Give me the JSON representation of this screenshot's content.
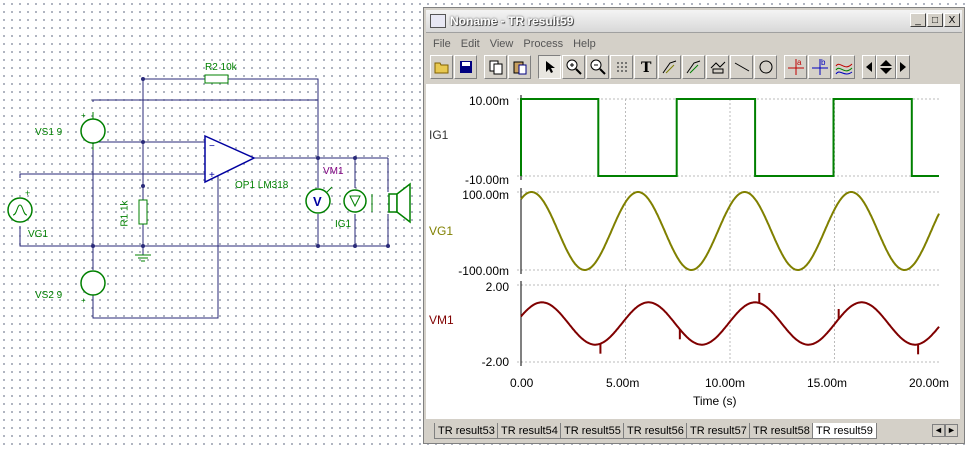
{
  "schematic": {
    "labels": {
      "r2": "R2 10k",
      "vs1": "VS1 9",
      "vs2": "VS2 9",
      "vg1": "VG1",
      "r1": "R1 1k",
      "op1": "OP1 LM318",
      "vm1": "VM1",
      "ig1": "IG1"
    },
    "colors": {
      "wire": "#2a2a7a",
      "component": "#008000",
      "label": "#800080"
    }
  },
  "window": {
    "title": "Noname - TR result59",
    "controls": {
      "minimize": "_",
      "maximize": "□",
      "close": "X"
    },
    "menu": [
      "File",
      "Edit",
      "View",
      "Process",
      "Help"
    ],
    "toolbar_icons": [
      "open-icon",
      "save-icon",
      "copy-icon",
      "paste-icon",
      "pointer-icon",
      "zoom-in-icon",
      "zoom-out-icon",
      "grid-icon",
      "text-icon",
      "cursor-a-icon",
      "cursor-b-icon",
      "marker-icon",
      "line-icon",
      "circle-icon",
      "cursor-a-red-icon",
      "cursor-b-blue-icon",
      "curves-icon",
      "nav-left-icon",
      "nav-updown-icon",
      "nav-right-icon"
    ]
  },
  "plot": {
    "x_ticks": [
      "0.00",
      "5.00m",
      "10.00m",
      "15.00m",
      "20.00m"
    ],
    "x_label": "Time (s)",
    "traces": [
      {
        "name": "IG1",
        "color": "#008000",
        "ticks": [
          "10.00m",
          "-10.00m"
        ]
      },
      {
        "name": "VG1",
        "color": "#808000",
        "ticks": [
          "100.00m",
          "-100.00m"
        ]
      },
      {
        "name": "VM1",
        "color": "#800000",
        "ticks": [
          "2.00",
          "-2.00"
        ]
      }
    ]
  },
  "chart_data": [
    {
      "type": "line",
      "series": [
        {
          "name": "IG1",
          "shape": "square",
          "period": 0.0075,
          "high": 0.01,
          "low": -0.01,
          "first_high_until": 0.0037
        }
      ],
      "xlabel": "Time (s)",
      "xlim": [
        0,
        0.02
      ],
      "ylim": [
        -0.01,
        0.01
      ]
    },
    {
      "type": "line",
      "series": [
        {
          "name": "VG1",
          "shape": "sine",
          "amplitude": 0.1,
          "period": 0.0051,
          "first_peak": 0.0005
        }
      ],
      "xlabel": "Time (s)",
      "xlim": [
        0,
        0.02
      ],
      "ylim": [
        -0.1,
        0.1
      ]
    },
    {
      "type": "line",
      "series": [
        {
          "name": "VM1",
          "shape": "sine",
          "amplitude": 1.1,
          "period": 0.0051,
          "first_peak": 0.001,
          "spikes_at": [
            0.0038,
            0.0076,
            0.0114,
            0.0152,
            0.019
          ]
        }
      ],
      "xlabel": "Time (s)",
      "xlim": [
        0,
        0.02
      ],
      "ylim": [
        -2.0,
        2.0
      ]
    }
  ],
  "tabs": [
    "TR result53",
    "TR result54",
    "TR result55",
    "TR result56",
    "TR result57",
    "TR result58",
    "TR result59"
  ],
  "active_tab": "TR result59"
}
